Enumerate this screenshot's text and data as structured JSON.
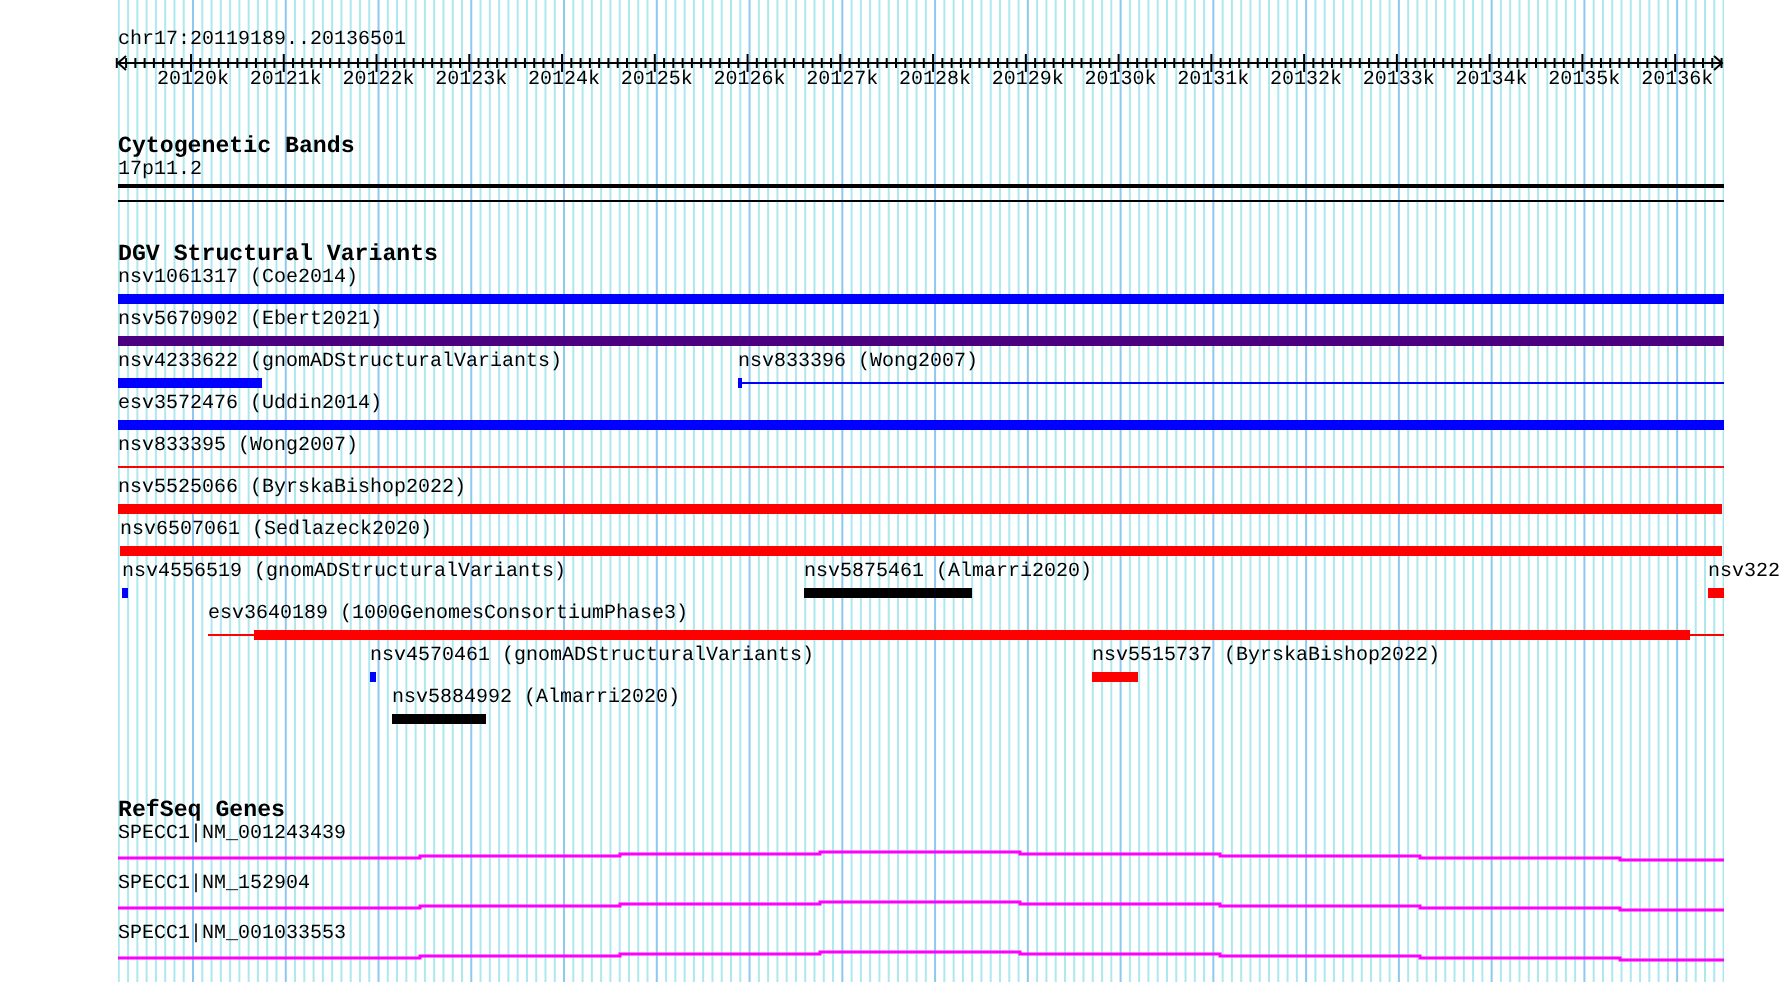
{
  "view": {
    "label": "chr17:20119189..20136501"
  },
  "ruler": {
    "ticks": [
      {
        "label": "20120k"
      },
      {
        "label": "20121k"
      },
      {
        "label": "20122k"
      },
      {
        "label": "20123k"
      },
      {
        "label": "20124k"
      },
      {
        "label": "20125k"
      },
      {
        "label": "20126k"
      },
      {
        "label": "20127k"
      },
      {
        "label": "20128k"
      },
      {
        "label": "20129k"
      },
      {
        "label": "20130k"
      },
      {
        "label": "20131k"
      },
      {
        "label": "20132k"
      },
      {
        "label": "20133k"
      },
      {
        "label": "20134k"
      },
      {
        "label": "20135k"
      },
      {
        "label": "20136k"
      }
    ]
  },
  "tracks": [
    {
      "title": "Cytogenetic Bands",
      "kind": "cytoband",
      "bands": [
        {
          "label": "17p11.2"
        }
      ]
    },
    {
      "title": "DGV Structural Variants",
      "kind": "variants",
      "rows": [
        {
          "features": [
            {
              "label": "nsv1061317 (Coe2014)",
              "kind": "bar",
              "color": "#0000ff"
            }
          ]
        },
        {
          "features": [
            {
              "label": "nsv5670902 (Ebert2021)",
              "kind": "bar",
              "color": "#4b0082"
            }
          ]
        },
        {
          "features": [
            {
              "label": "nsv4233622 (gnomADStructuralVariants)",
              "kind": "bar",
              "color": "#0000ff"
            },
            {
              "label": "nsv833396 (Wong2007)",
              "kind": "line",
              "color": "#0000ff"
            }
          ]
        },
        {
          "features": [
            {
              "label": "esv3572476 (Uddin2014)",
              "kind": "bar",
              "color": "#0000ff"
            }
          ]
        },
        {
          "features": [
            {
              "label": "nsv833395 (Wong2007)",
              "kind": "line",
              "color": "#ff0000"
            }
          ]
        },
        {
          "features": [
            {
              "label": "nsv5525066 (ByrskaBishop2022)",
              "kind": "bar",
              "color": "#ff0000"
            }
          ]
        },
        {
          "features": [
            {
              "label": "nsv6507061 (Sedlazeck2020)",
              "kind": "bar",
              "color": "#ff0000"
            }
          ]
        },
        {
          "features": [
            {
              "label": "nsv4556519 (gnomADStructuralVariants)",
              "kind": "bar",
              "color": "#0000ff"
            },
            {
              "label": "nsv5875461 (Almarri2020)",
              "kind": "bar",
              "color": "#000000"
            },
            {
              "label": "nsv322",
              "kind": "bar",
              "color": "#ff0000"
            }
          ]
        },
        {
          "features": [
            {
              "label": "esv3640189 (1000GenomesConsortiumPhase3)",
              "kind": "line",
              "color": "#ff0000"
            }
          ]
        },
        {
          "features": [
            {
              "label": "nsv4570461 (gnomADStructuralVariants)",
              "kind": "bar",
              "color": "#0000ff"
            },
            {
              "label": "nsv5515737 (ByrskaBishop2022)",
              "kind": "bar",
              "color": "#ff0000"
            }
          ]
        },
        {
          "features": [
            {
              "label": "nsv5884992 (Almarri2020)",
              "kind": "bar",
              "color": "#000000"
            }
          ]
        }
      ]
    },
    {
      "title": "RefSeq Genes",
      "kind": "genes",
      "genes": [
        {
          "label": "SPECC1|NM_001243439"
        },
        {
          "label": "SPECC1|NM_152904"
        },
        {
          "label": "SPECC1|NM_001033553"
        }
      ]
    }
  ]
}
